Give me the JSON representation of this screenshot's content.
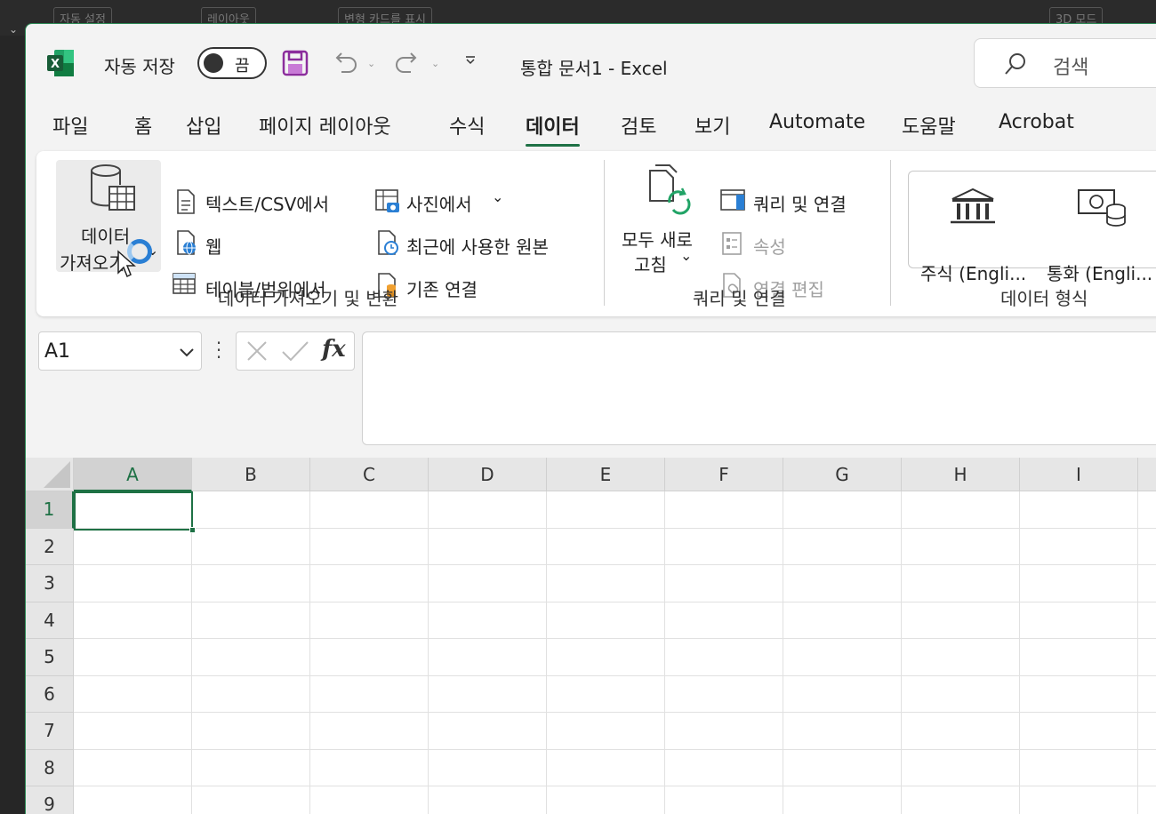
{
  "background": {
    "ghost_items": [
      "자동 설정",
      "레이아웃",
      "변형 카드를 표시",
      "3D 모드"
    ]
  },
  "titlebar": {
    "app_icon": "excel-logo-icon",
    "autosave_label": "자동 저장",
    "autosave_state": "끔",
    "document_title": "통합 문서1  -  Excel",
    "search_placeholder": "검색"
  },
  "tabs": [
    {
      "label": "파일"
    },
    {
      "label": "홈"
    },
    {
      "label": "삽입"
    },
    {
      "label": "페이지 레이아웃"
    },
    {
      "label": "수식"
    },
    {
      "label": "데이터",
      "active": true
    },
    {
      "label": "검토"
    },
    {
      "label": "보기"
    },
    {
      "label": "Automate"
    },
    {
      "label": "도움말"
    },
    {
      "label": "Acrobat"
    }
  ],
  "ribbon": {
    "get_data": {
      "line1": "데이터",
      "line2": "가져오기",
      "chevron": "⌄"
    },
    "text_csv": "텍스트/CSV에서",
    "web": "웹",
    "table_range": "테이블/범위에서",
    "from_picture": "사진에서",
    "recent_sources": "최근에 사용한 원본",
    "existing_connections": "기존 연결",
    "group1_label": "데이터 가져오기 및 변환",
    "refresh_all": {
      "line1": "모두 새로",
      "line2": "고침",
      "chevron": "⌄"
    },
    "queries_connections": "쿼리 및 연결",
    "properties": "속성",
    "edit_links": "연결 편집",
    "group2_label": "쿼리 및 연결",
    "stocks": "주식 (Engli...",
    "currencies": "통화 (Engli...",
    "group3_label": "데이터 형식"
  },
  "formula_bar": {
    "name_box": "A1",
    "fx": "fx",
    "formula": ""
  },
  "grid": {
    "columns": [
      "A",
      "B",
      "C",
      "D",
      "E",
      "F",
      "G",
      "H",
      "I"
    ],
    "rows": [
      "1",
      "2",
      "3",
      "4",
      "5",
      "6",
      "7",
      "8",
      "9"
    ],
    "selected_cell": "A1"
  },
  "colors": {
    "excel_green": "#1e7145",
    "accent_blue": "#2a7fd4"
  }
}
